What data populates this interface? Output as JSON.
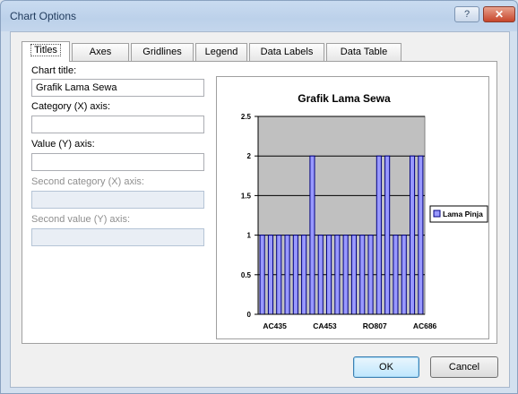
{
  "window": {
    "title": "Chart Options",
    "help_label": "?",
    "close_label": "✕"
  },
  "tabs": [
    "Titles",
    "Axes",
    "Gridlines",
    "Legend",
    "Data Labels",
    "Data Table"
  ],
  "titles_panel": {
    "chart_title_label": "Chart title:",
    "chart_title_value": "Grafik Lama Sewa",
    "category_x_label": "Category (X) axis:",
    "category_x_value": "",
    "value_y_label": "Value (Y) axis:",
    "value_y_value": "",
    "second_category_label": "Second category (X) axis:",
    "second_value_label": "Second value (Y) axis:"
  },
  "buttons": {
    "ok": "OK",
    "cancel": "Cancel"
  },
  "colors": {
    "plot_area": "#c0c0c0",
    "bar_fill": "#9999ff",
    "bar_border": "#000080"
  },
  "chart_data": {
    "type": "bar",
    "title": "Grafik Lama Sewa",
    "xlabel": "",
    "ylabel": "",
    "ylim": [
      0,
      2.5
    ],
    "yticks": [
      "0",
      "0.5",
      "1",
      "1.5",
      "2",
      "2.5"
    ],
    "categories": [
      "AC435",
      "",
      "",
      "",
      "",
      "",
      "CA453",
      "",
      "",
      "",
      "",
      "",
      "RO807",
      "",
      "",
      "",
      "",
      "",
      "AC686",
      ""
    ],
    "series": [
      {
        "name": "Lama Pinja",
        "values": [
          1,
          1,
          1,
          1,
          1,
          1,
          2,
          1,
          1,
          1,
          1,
          1,
          1,
          1,
          2,
          2,
          1,
          1,
          2,
          2
        ]
      }
    ],
    "grid": true,
    "legend": "right"
  }
}
